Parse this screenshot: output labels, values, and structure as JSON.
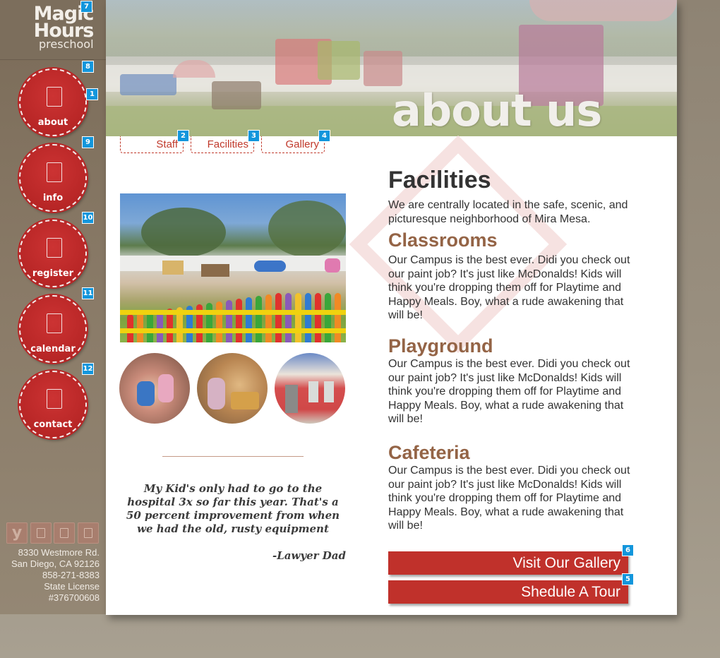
{
  "brand": {
    "line1": "Magic",
    "line2": "Hours",
    "line3": "preschool"
  },
  "nav": [
    {
      "label": "about",
      "icon": "document-icon"
    },
    {
      "label": "info",
      "icon": "info-icon"
    },
    {
      "label": "register",
      "icon": "register-icon"
    },
    {
      "label": "calendar",
      "icon": "calendar-icon"
    },
    {
      "label": "contact",
      "icon": "contact-icon"
    }
  ],
  "social": [
    {
      "label": "y",
      "icon": "yelp-icon"
    },
    {
      "label": "",
      "icon": "facebook-icon"
    },
    {
      "label": "",
      "icon": "google-plus-icon"
    },
    {
      "label": "",
      "icon": "twitter-icon"
    }
  ],
  "address": {
    "street": "8330 Westmore Rd.",
    "city": "San Diego, CA 92126",
    "phone": "858-271-8383",
    "license_label": "State License",
    "license_number": "#376700608"
  },
  "hero": {
    "title": "about us"
  },
  "tabs": {
    "staff": "Staff",
    "facilities": "Facilities",
    "gallery": "Gallery"
  },
  "main": {
    "heading": "Facilities",
    "intro": "We are centrally located in the safe, scenic, and picturesque neighborhood of Mira Mesa.",
    "sections": [
      {
        "title": "Classrooms",
        "text": "Our Campus is the best ever. Didi you check out our paint job? It's just like McDonalds! Kids will think you're dropping them off for Playtime and Happy Meals. Boy, what a rude awakening that will be!"
      },
      {
        "title": "Playground",
        "text": "Our Campus is the best ever. Didi you check out our paint job? It's just like McDonalds! Kids will think you're dropping them off for Playtime and Happy Meals. Boy, what a rude awakening that will be!"
      },
      {
        "title": "Cafeteria",
        "text": "Our Campus is the best ever. Didi you check out our paint job? It's just like McDonalds! Kids will think you're dropping them off for Playtime and Happy Meals. Boy, what a rude awakening that will be!"
      }
    ]
  },
  "testimonial": {
    "quote": "My Kid's only had to go to the hospital 3x so far this year. That's a 50 percent improvement from when we had the old, rusty  equipment",
    "author": "-Lawyer Dad"
  },
  "buttons": {
    "gallery": "Visit Our Gallery",
    "tour": "Shedule A Tour"
  },
  "badges": [
    "1",
    "2",
    "3",
    "4",
    "5",
    "6",
    "7",
    "8",
    "9",
    "10",
    "11",
    "12"
  ],
  "colors": {
    "accent": "#c0312b",
    "heading_brown": "#946446",
    "badge": "#1296dc"
  }
}
